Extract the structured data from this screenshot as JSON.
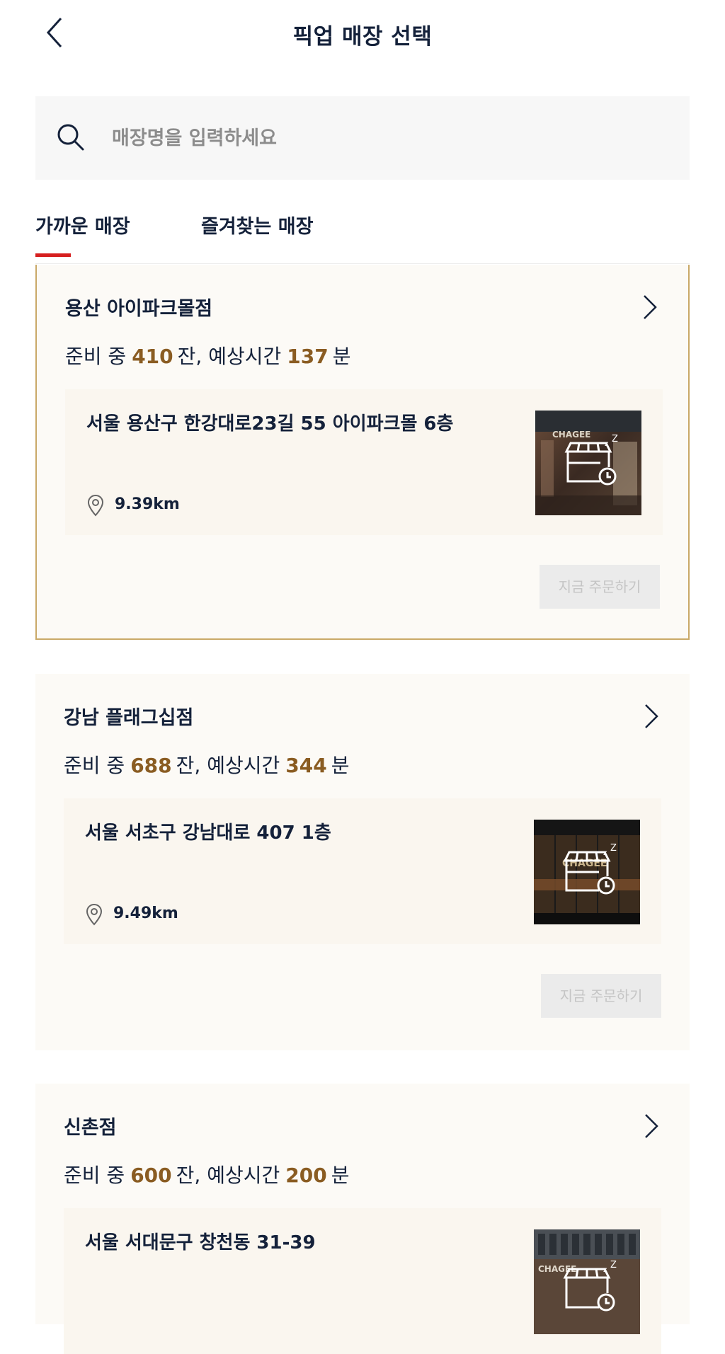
{
  "header": {
    "title": "픽업 매장 선택"
  },
  "search": {
    "placeholder": "매장명을 입력하세요",
    "value": ""
  },
  "tabs": [
    {
      "label": "가까운 매장",
      "active": true
    },
    {
      "label": "즐겨찾는 매장",
      "active": false
    }
  ],
  "colors": {
    "accent_number": "#8a5c22",
    "tab_indicator": "#d61f1f",
    "selected_border": "#c9a968",
    "card_bg": "#fcfaf6"
  },
  "stores": [
    {
      "name": "용산 아이파크몰점",
      "status_prefix": "준비 중",
      "cups": "410",
      "cups_unit": "잔, 예상시간",
      "minutes": "137",
      "minutes_unit": "분",
      "address": "서울 용산구 한강대로23길 55 아이파크몰 6층",
      "distance": "9.39km",
      "order_label": "지금 주문하기",
      "selected": true,
      "photo_sign": "CHAGEE"
    },
    {
      "name": "강남 플래그십점",
      "status_prefix": "준비 중",
      "cups": "688",
      "cups_unit": "잔, 예상시간",
      "minutes": "344",
      "minutes_unit": "분",
      "address": "서울 서초구 강남대로 407 1층",
      "distance": "9.49km",
      "order_label": "지금 주문하기",
      "selected": false,
      "photo_sign": "CHAGEE"
    },
    {
      "name": "신촌점",
      "status_prefix": "준비 중",
      "cups": "600",
      "cups_unit": "잔, 예상시간",
      "minutes": "200",
      "minutes_unit": "분",
      "address": "서울 서대문구 창천동 31-39",
      "selected": false,
      "photo_sign": "CHAGEE"
    }
  ]
}
